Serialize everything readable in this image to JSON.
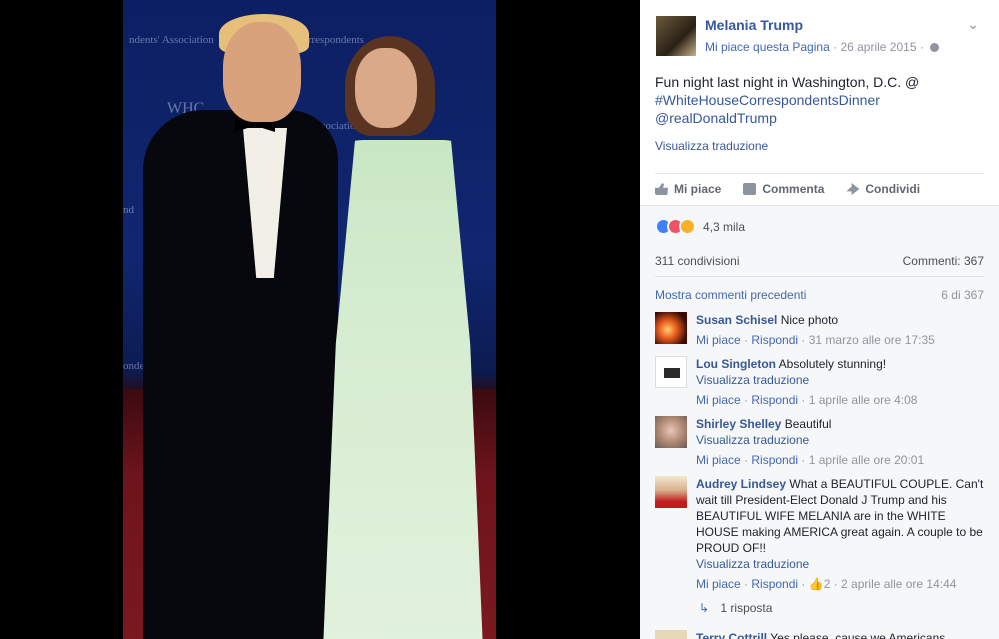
{
  "photo": {
    "wall_texts": [
      "ndents' Association",
      "Correspondents",
      "WHC",
      "Association",
      "ondents'",
      "nd"
    ]
  },
  "post": {
    "page_name": "Melania Trump",
    "like_page_label": "Mi piace questa Pagina",
    "date": "26 aprile 2015",
    "text_line1": "Fun night last night in Washington, D.C. @",
    "hashtag": "#WhiteHouseCorrespondentsDinner",
    "mention": "@realDonaldTrump",
    "translate_label": "Visualizza traduzione"
  },
  "actions": {
    "like": "Mi piace",
    "comment": "Commenta",
    "share": "Condividi"
  },
  "feedback": {
    "reactions_count": "4,3 mila",
    "shares": "311 condivisioni",
    "comments": "Commenti: 367",
    "prev_comments_label": "Mostra commenti precedenti",
    "prev_comments_count": "6 di 367"
  },
  "comments": [
    {
      "name": "Susan Schisel",
      "text": "Nice photo",
      "translate": "",
      "like": "Mi piace",
      "reply": "Rispondi",
      "likes": "",
      "time": "31 marzo alle ore 17:35"
    },
    {
      "name": "Lou Singleton",
      "text": "Absolutely stunning!",
      "translate": "Visualizza traduzione",
      "like": "Mi piace",
      "reply": "Rispondi",
      "likes": "",
      "time": "1 aprile alle ore 4:08"
    },
    {
      "name": "Shirley Shelley",
      "text": "Beautiful",
      "translate": "Visualizza traduzione",
      "like": "Mi piace",
      "reply": "Rispondi",
      "likes": "",
      "time": "1 aprile alle ore 20:01"
    },
    {
      "name": "Audrey Lindsey",
      "text": "What a BEAUTIFUL COUPLE. Can't wait till President-Elect Donald J Trump and his BEAUTIFUL WIFE MELANIA are in the WHITE HOUSE making AMERICA great again. A couple to be PROUD OF!!",
      "translate": "Visualizza traduzione",
      "like": "Mi piace",
      "reply": "Rispondi",
      "likes": "2",
      "time": "2 aprile alle ore 14:44",
      "replies_label": "1 risposta"
    },
    {
      "name": "Terry Cottrill",
      "text": "Yes please, cause we Americans"
    }
  ]
}
